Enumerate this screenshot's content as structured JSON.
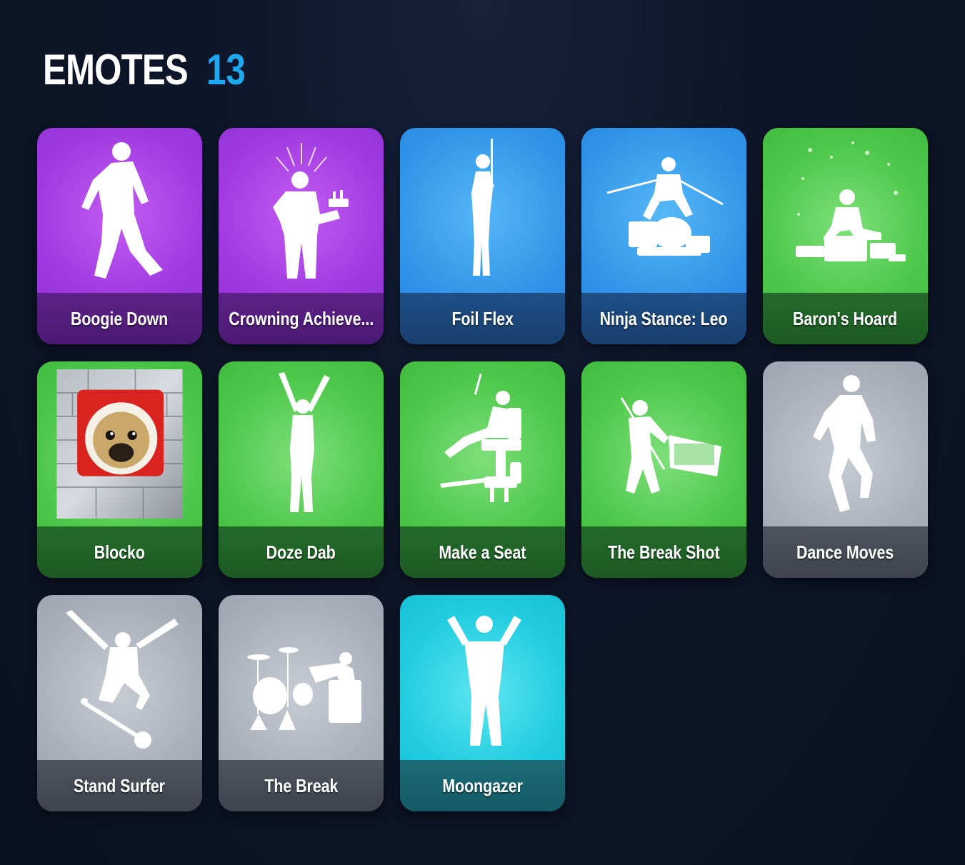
{
  "header": {
    "title": "EMOTES",
    "count": "13"
  },
  "colors": {
    "accent": "#1ea8f0",
    "purple": "#a03ae0",
    "blue": "#2f93e8",
    "green": "#4ec84a",
    "gray": "#a9afb9",
    "cyan": "#22cde0"
  },
  "emotes": [
    {
      "name": "Boogie Down",
      "rarity": "purple",
      "icon": "dancing-figure-icon"
    },
    {
      "name": "Crowning Achieve...",
      "rarity": "purple",
      "icon": "figure-with-cake-icon"
    },
    {
      "name": "Foil Flex",
      "rarity": "blue",
      "icon": "figure-with-sword-icon"
    },
    {
      "name": "Ninja Stance: Leo",
      "rarity": "blue",
      "icon": "ninja-figure-icon"
    },
    {
      "name": "Baron's Hoard",
      "rarity": "green",
      "icon": "figure-sitting-on-treasure-icon"
    },
    {
      "name": "Blocko",
      "rarity": "green",
      "icon": "pug-spray-icon"
    },
    {
      "name": "Doze Dab",
      "rarity": "green",
      "icon": "arms-raised-figure-icon"
    },
    {
      "name": "Make a Seat",
      "rarity": "green",
      "icon": "figure-on-chair-icon"
    },
    {
      "name": "The Break Shot",
      "rarity": "green",
      "icon": "figure-playing-pool-icon"
    },
    {
      "name": "Dance Moves",
      "rarity": "gray",
      "icon": "dancing-figure-icon"
    },
    {
      "name": "Stand Surfer",
      "rarity": "gray",
      "icon": "skateboard-figure-icon"
    },
    {
      "name": "The Break",
      "rarity": "gray",
      "icon": "drum-kit-figure-icon"
    },
    {
      "name": "Moongazer",
      "rarity": "cyan",
      "icon": "pointing-figure-icon"
    }
  ]
}
